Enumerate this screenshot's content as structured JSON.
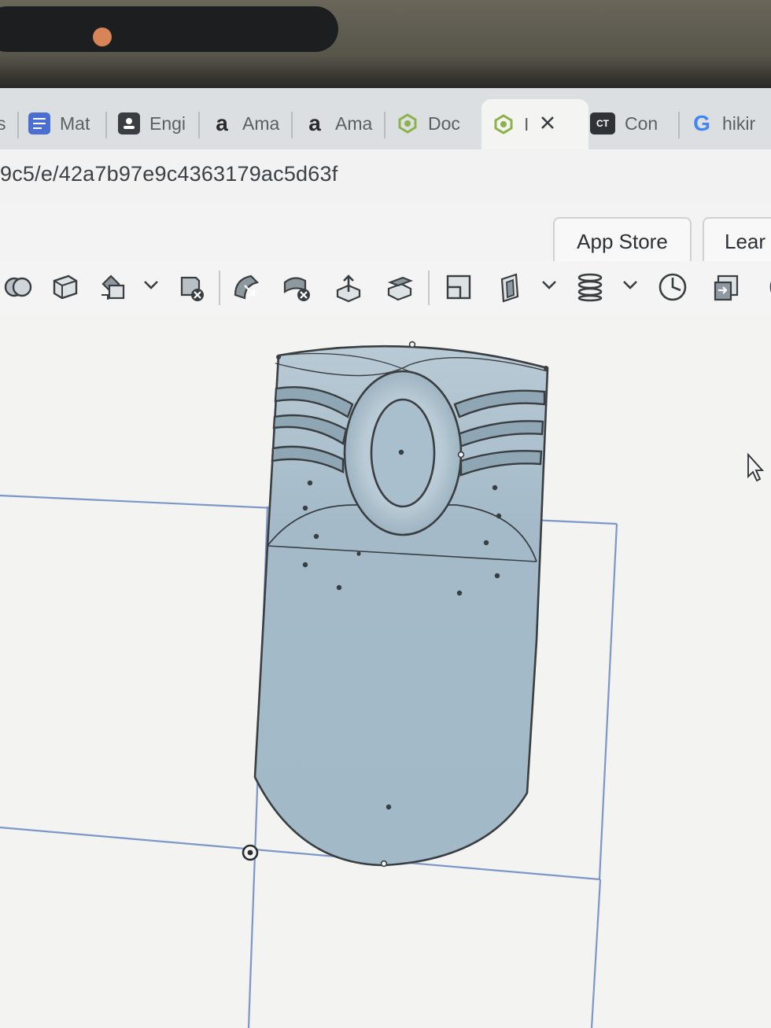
{
  "browser": {
    "tabs": [
      {
        "label": "s",
        "icon": "partial-tab-icon"
      },
      {
        "label": "Mat",
        "icon": "docs-icon",
        "color": "#4a6fd1"
      },
      {
        "label": "Engi",
        "icon": "contact-card-icon",
        "color": "#3a3d41"
      },
      {
        "label": "Ama",
        "icon": "amazon-icon",
        "color": "#2b2b2b"
      },
      {
        "label": "Ama",
        "icon": "amazon-icon",
        "color": "#2b2b2b"
      },
      {
        "label": "Doc",
        "icon": "onshape-icon",
        "color": "#8ab34a"
      },
      {
        "label": "I",
        "icon": "onshape-icon",
        "color": "#8ab34a",
        "active": true
      },
      {
        "label": "Con",
        "icon": "ct-icon",
        "color": "#2f3236"
      },
      {
        "label": "hikir",
        "icon": "google-icon",
        "color": "#4285f4"
      }
    ],
    "url": "9c5/e/42a7b97e9c4363179ac5d63f"
  },
  "appbar": {
    "app_store_label": "App Store",
    "learn_label": "Lear"
  },
  "toolbar": {
    "tools": [
      "boolean-icon",
      "plane-icon",
      "transform-icon",
      "delete-part-icon",
      "sweep-icon",
      "delete-face-icon",
      "extrude-face-icon",
      "move-face-icon",
      "split-icon",
      "shell-icon",
      "helix-icon",
      "mate-clock-icon",
      "derived-icon"
    ]
  },
  "colors": {
    "part_fill": "#9fb7c6",
    "part_stroke": "#3a3e41",
    "sketch_line": "#7d96c9"
  }
}
